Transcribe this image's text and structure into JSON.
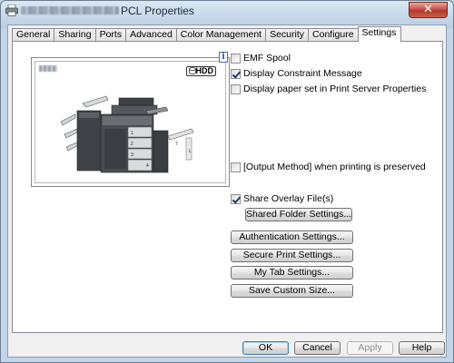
{
  "window": {
    "title_suffix": "PCL Properties",
    "close_symbol": "✕"
  },
  "tabs": [
    {
      "label": "General"
    },
    {
      "label": "Sharing"
    },
    {
      "label": "Ports"
    },
    {
      "label": "Advanced"
    },
    {
      "label": "Color Management"
    },
    {
      "label": "Security"
    },
    {
      "label": "Configure"
    },
    {
      "label": "Settings",
      "active": true
    }
  ],
  "preview": {
    "badge": "HDD",
    "info_symbol": "i"
  },
  "options": {
    "emf_spool": {
      "label": "EMF Spool",
      "checked": false
    },
    "display_constraint": {
      "label": "Display Constraint Message",
      "checked": true
    },
    "display_paper_set": {
      "label": "Display paper set in Print Server Properties",
      "checked": false
    },
    "output_method_preserved": {
      "label": "[Output Method] when printing is preserved",
      "checked": false
    },
    "share_overlay": {
      "label": "Share Overlay File(s)",
      "checked": true
    }
  },
  "buttons": {
    "shared_folder": "Shared Folder Settings...",
    "authentication": "Authentication Settings...",
    "secure_print": "Secure Print Settings...",
    "my_tab": "My Tab Settings...",
    "save_custom_size": "Save Custom Size..."
  },
  "dialog_buttons": {
    "ok": "OK",
    "cancel": "Cancel",
    "apply": "Apply",
    "help": "Help"
  },
  "colors": {
    "window_frame": "#c4d5e8",
    "default_button_border": "#3c7fb1",
    "close_button": "#c75050"
  }
}
